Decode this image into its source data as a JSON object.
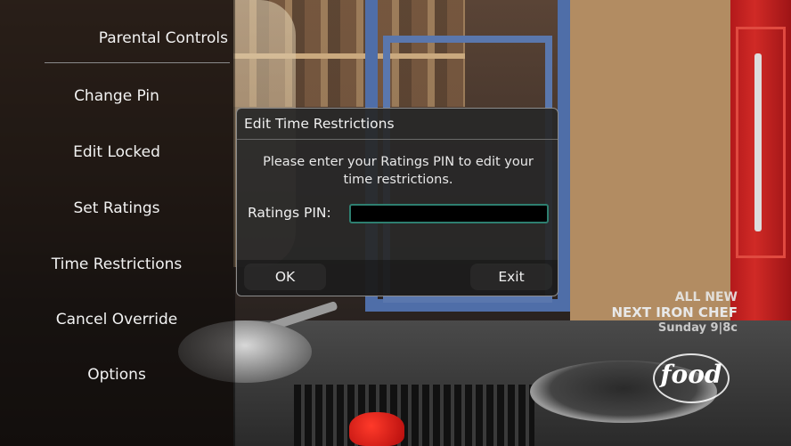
{
  "menu": {
    "title": "Parental Controls",
    "items": [
      {
        "label": "Change Pin"
      },
      {
        "label": "Edit Locked"
      },
      {
        "label": "Set Ratings"
      },
      {
        "label": "Time Restrictions"
      },
      {
        "label": "Cancel Override"
      },
      {
        "label": "Options"
      }
    ]
  },
  "dialog": {
    "title": "Edit Time Restrictions",
    "message": "Please enter your Ratings PIN to edit your time restrictions.",
    "pin_label": "Ratings PIN:",
    "pin_value": "",
    "ok_label": "OK",
    "exit_label": "Exit",
    "focus_color": "#2e7f70"
  },
  "promo": {
    "line1": "ALL NEW",
    "line2": "NEXT IRON CHEF",
    "line3": "Sunday 9|8c"
  },
  "channel_logo": {
    "text": "food",
    "icon": "food-network-logo"
  }
}
